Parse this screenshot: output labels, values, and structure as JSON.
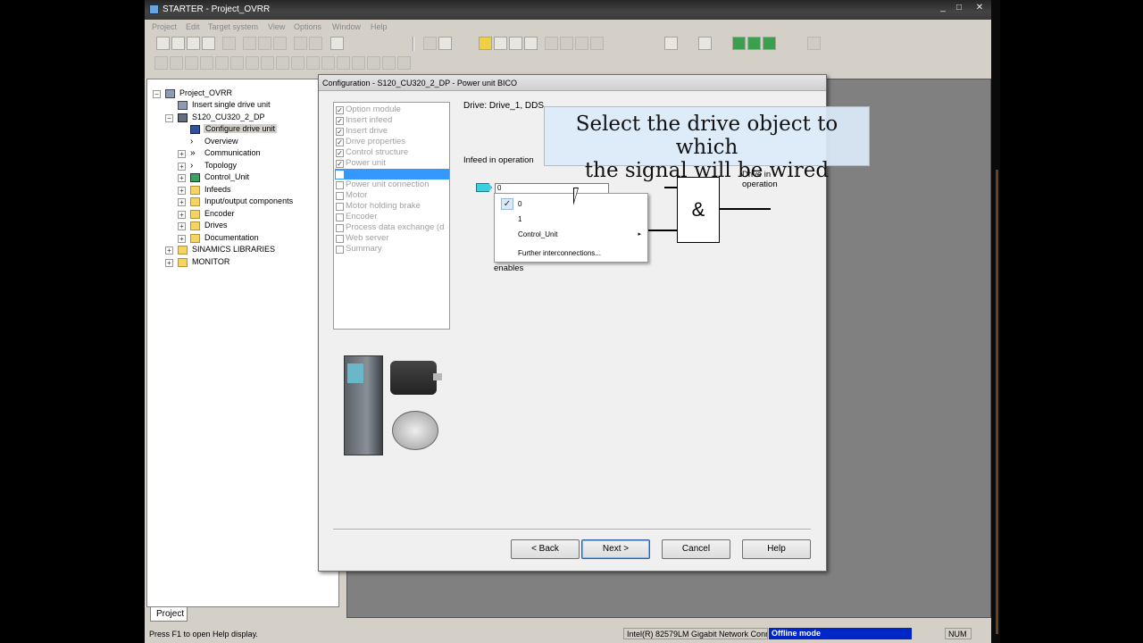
{
  "window": {
    "title": "STARTER - Project_OVRR",
    "controls": [
      "_",
      "□",
      "✕"
    ]
  },
  "menu": [
    "Project",
    "Edit",
    "Target system",
    "View",
    "Options",
    "Window",
    "Help"
  ],
  "tree": {
    "items": [
      {
        "label": "Project_OVRR",
        "icon": "project-icon"
      },
      {
        "label": "Insert single drive unit",
        "icon": "insert-icon"
      },
      {
        "label": "S120_CU320_2_DP",
        "icon": "drive-unit-icon"
      },
      {
        "label": "Configure drive unit",
        "icon": "configure-icon"
      },
      {
        "label": "Overview",
        "icon": "chevron-icon"
      },
      {
        "label": "Communication",
        "icon": "chevron-icon"
      },
      {
        "label": "Topology",
        "icon": "chevron-icon"
      },
      {
        "label": "Control_Unit",
        "icon": "control-unit-icon"
      },
      {
        "label": "Infeeds",
        "icon": "folder-icon"
      },
      {
        "label": "Input/output components",
        "icon": "folder-icon"
      },
      {
        "label": "Encoder",
        "icon": "folder-icon"
      },
      {
        "label": "Drives",
        "icon": "folder-icon"
      },
      {
        "label": "Documentation",
        "icon": "folder-icon"
      },
      {
        "label": "SINAMICS LIBRARIES",
        "icon": "folder-icon"
      },
      {
        "label": "MONITOR",
        "icon": "folder-icon"
      }
    ],
    "tab": "Project"
  },
  "statusbar": {
    "help": "Press F1 to open Help display.",
    "network": "Intel(R) 82579LM Gigabit Network Conn",
    "mode": "Offline mode",
    "num": "NUM"
  },
  "dialog": {
    "title": "Configuration - S120_CU320_2_DP - Power unit BICO",
    "steps": [
      {
        "label": "Option module",
        "checked": true
      },
      {
        "label": "Insert infeed",
        "checked": true
      },
      {
        "label": "Insert drive",
        "checked": true
      },
      {
        "label": "Drive properties",
        "checked": true
      },
      {
        "label": "Control structure",
        "checked": true
      },
      {
        "label": "Power unit",
        "checked": true
      },
      {
        "label": "",
        "checked": false,
        "active": true
      },
      {
        "label": "Power unit connection",
        "checked": false
      },
      {
        "label": "Motor",
        "checked": false
      },
      {
        "label": "Motor holding brake",
        "checked": false
      },
      {
        "label": "Encoder",
        "checked": false
      },
      {
        "label": "Process data exchange (d",
        "checked": false
      },
      {
        "label": "Web server",
        "checked": false
      },
      {
        "label": "Summary",
        "checked": false
      }
    ],
    "drive_label": "Drive: Drive_1, DDS",
    "infeed_label": "Infeed in operation",
    "signal_value": "0",
    "enables_label": "enables",
    "gate_symbol": "&",
    "output_label": "Drive in operation",
    "popup": {
      "items": [
        "0",
        "1",
        "Control_Unit",
        "Further interconnections..."
      ],
      "check_mark": "✓",
      "submenu_arrow": "▸"
    },
    "buttons": {
      "back": "< Back",
      "next": "Next >",
      "cancel": "Cancel",
      "help": "Help"
    }
  },
  "callout": {
    "line1": "Select the drive object to which",
    "line2": "the signal will be wired"
  }
}
